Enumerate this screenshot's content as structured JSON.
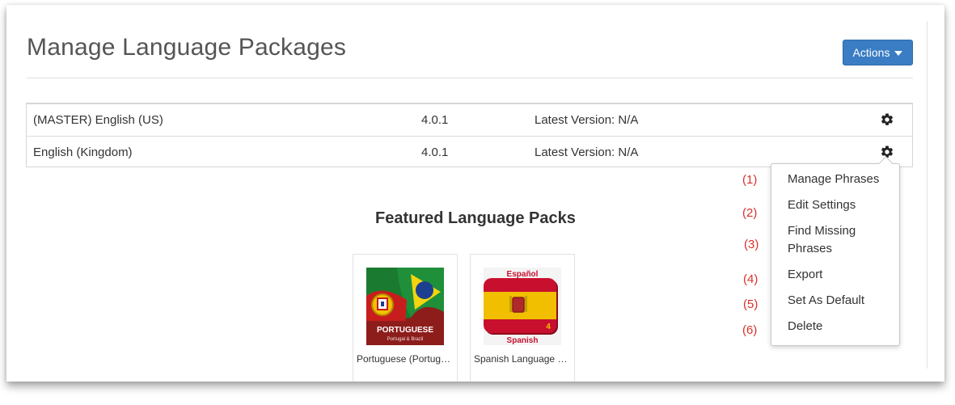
{
  "page": {
    "title": "Manage Language Packages",
    "actions_label": "Actions"
  },
  "packages": [
    {
      "name": "(MASTER) English (US)",
      "version": "4.0.1",
      "latest": "Latest Version: N/A"
    },
    {
      "name": "English (Kingdom)",
      "version": "4.0.1",
      "latest": "Latest Version: N/A"
    }
  ],
  "menu": {
    "items": [
      {
        "number": "(1)",
        "label": "Manage Phrases"
      },
      {
        "number": "(2)",
        "label": "Edit Settings"
      },
      {
        "number": "(3)",
        "label": "Find Missing Phrases"
      },
      {
        "number": "(4)",
        "label": "Export"
      },
      {
        "number": "(5)",
        "label": "Set As Default"
      },
      {
        "number": "(6)",
        "label": "Delete"
      }
    ]
  },
  "featured": {
    "heading": "Featured Language Packs",
    "packs": [
      {
        "label": "Portuguese (Portugal ...",
        "image_title": "PORTUGUESE",
        "image_subtitle": "Portugal & Brazil"
      },
      {
        "label": "Spanish Language Pack",
        "image_top": "Español",
        "image_bottom": "Spanish",
        "image_badge": "4"
      }
    ]
  },
  "colors": {
    "accent": "#3a7dc4",
    "annotation_red": "#d9302c",
    "portuguese_bg": "#8c1d1b",
    "spanish_red": "#c8102e",
    "spanish_yellow": "#f1bf00"
  },
  "icons": [
    "caret-down-icon",
    "gear-icon"
  ]
}
